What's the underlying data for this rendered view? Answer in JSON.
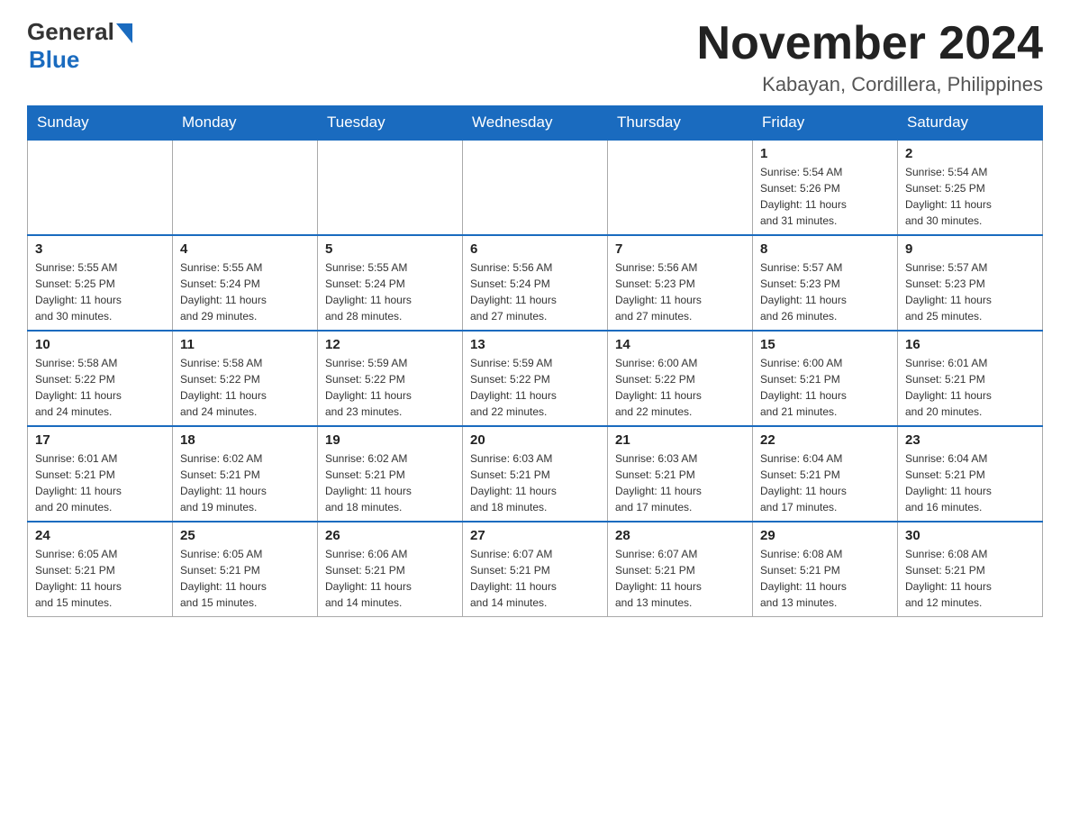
{
  "logo": {
    "general": "General",
    "blue": "Blue"
  },
  "title": "November 2024",
  "location": "Kabayan, Cordillera, Philippines",
  "days_of_week": [
    "Sunday",
    "Monday",
    "Tuesday",
    "Wednesday",
    "Thursday",
    "Friday",
    "Saturday"
  ],
  "weeks": [
    [
      {
        "day": "",
        "info": ""
      },
      {
        "day": "",
        "info": ""
      },
      {
        "day": "",
        "info": ""
      },
      {
        "day": "",
        "info": ""
      },
      {
        "day": "",
        "info": ""
      },
      {
        "day": "1",
        "info": "Sunrise: 5:54 AM\nSunset: 5:26 PM\nDaylight: 11 hours\nand 31 minutes."
      },
      {
        "day": "2",
        "info": "Sunrise: 5:54 AM\nSunset: 5:25 PM\nDaylight: 11 hours\nand 30 minutes."
      }
    ],
    [
      {
        "day": "3",
        "info": "Sunrise: 5:55 AM\nSunset: 5:25 PM\nDaylight: 11 hours\nand 30 minutes."
      },
      {
        "day": "4",
        "info": "Sunrise: 5:55 AM\nSunset: 5:24 PM\nDaylight: 11 hours\nand 29 minutes."
      },
      {
        "day": "5",
        "info": "Sunrise: 5:55 AM\nSunset: 5:24 PM\nDaylight: 11 hours\nand 28 minutes."
      },
      {
        "day": "6",
        "info": "Sunrise: 5:56 AM\nSunset: 5:24 PM\nDaylight: 11 hours\nand 27 minutes."
      },
      {
        "day": "7",
        "info": "Sunrise: 5:56 AM\nSunset: 5:23 PM\nDaylight: 11 hours\nand 27 minutes."
      },
      {
        "day": "8",
        "info": "Sunrise: 5:57 AM\nSunset: 5:23 PM\nDaylight: 11 hours\nand 26 minutes."
      },
      {
        "day": "9",
        "info": "Sunrise: 5:57 AM\nSunset: 5:23 PM\nDaylight: 11 hours\nand 25 minutes."
      }
    ],
    [
      {
        "day": "10",
        "info": "Sunrise: 5:58 AM\nSunset: 5:22 PM\nDaylight: 11 hours\nand 24 minutes."
      },
      {
        "day": "11",
        "info": "Sunrise: 5:58 AM\nSunset: 5:22 PM\nDaylight: 11 hours\nand 24 minutes."
      },
      {
        "day": "12",
        "info": "Sunrise: 5:59 AM\nSunset: 5:22 PM\nDaylight: 11 hours\nand 23 minutes."
      },
      {
        "day": "13",
        "info": "Sunrise: 5:59 AM\nSunset: 5:22 PM\nDaylight: 11 hours\nand 22 minutes."
      },
      {
        "day": "14",
        "info": "Sunrise: 6:00 AM\nSunset: 5:22 PM\nDaylight: 11 hours\nand 22 minutes."
      },
      {
        "day": "15",
        "info": "Sunrise: 6:00 AM\nSunset: 5:21 PM\nDaylight: 11 hours\nand 21 minutes."
      },
      {
        "day": "16",
        "info": "Sunrise: 6:01 AM\nSunset: 5:21 PM\nDaylight: 11 hours\nand 20 minutes."
      }
    ],
    [
      {
        "day": "17",
        "info": "Sunrise: 6:01 AM\nSunset: 5:21 PM\nDaylight: 11 hours\nand 20 minutes."
      },
      {
        "day": "18",
        "info": "Sunrise: 6:02 AM\nSunset: 5:21 PM\nDaylight: 11 hours\nand 19 minutes."
      },
      {
        "day": "19",
        "info": "Sunrise: 6:02 AM\nSunset: 5:21 PM\nDaylight: 11 hours\nand 18 minutes."
      },
      {
        "day": "20",
        "info": "Sunrise: 6:03 AM\nSunset: 5:21 PM\nDaylight: 11 hours\nand 18 minutes."
      },
      {
        "day": "21",
        "info": "Sunrise: 6:03 AM\nSunset: 5:21 PM\nDaylight: 11 hours\nand 17 minutes."
      },
      {
        "day": "22",
        "info": "Sunrise: 6:04 AM\nSunset: 5:21 PM\nDaylight: 11 hours\nand 17 minutes."
      },
      {
        "day": "23",
        "info": "Sunrise: 6:04 AM\nSunset: 5:21 PM\nDaylight: 11 hours\nand 16 minutes."
      }
    ],
    [
      {
        "day": "24",
        "info": "Sunrise: 6:05 AM\nSunset: 5:21 PM\nDaylight: 11 hours\nand 15 minutes."
      },
      {
        "day": "25",
        "info": "Sunrise: 6:05 AM\nSunset: 5:21 PM\nDaylight: 11 hours\nand 15 minutes."
      },
      {
        "day": "26",
        "info": "Sunrise: 6:06 AM\nSunset: 5:21 PM\nDaylight: 11 hours\nand 14 minutes."
      },
      {
        "day": "27",
        "info": "Sunrise: 6:07 AM\nSunset: 5:21 PM\nDaylight: 11 hours\nand 14 minutes."
      },
      {
        "day": "28",
        "info": "Sunrise: 6:07 AM\nSunset: 5:21 PM\nDaylight: 11 hours\nand 13 minutes."
      },
      {
        "day": "29",
        "info": "Sunrise: 6:08 AM\nSunset: 5:21 PM\nDaylight: 11 hours\nand 13 minutes."
      },
      {
        "day": "30",
        "info": "Sunrise: 6:08 AM\nSunset: 5:21 PM\nDaylight: 11 hours\nand 12 minutes."
      }
    ]
  ]
}
